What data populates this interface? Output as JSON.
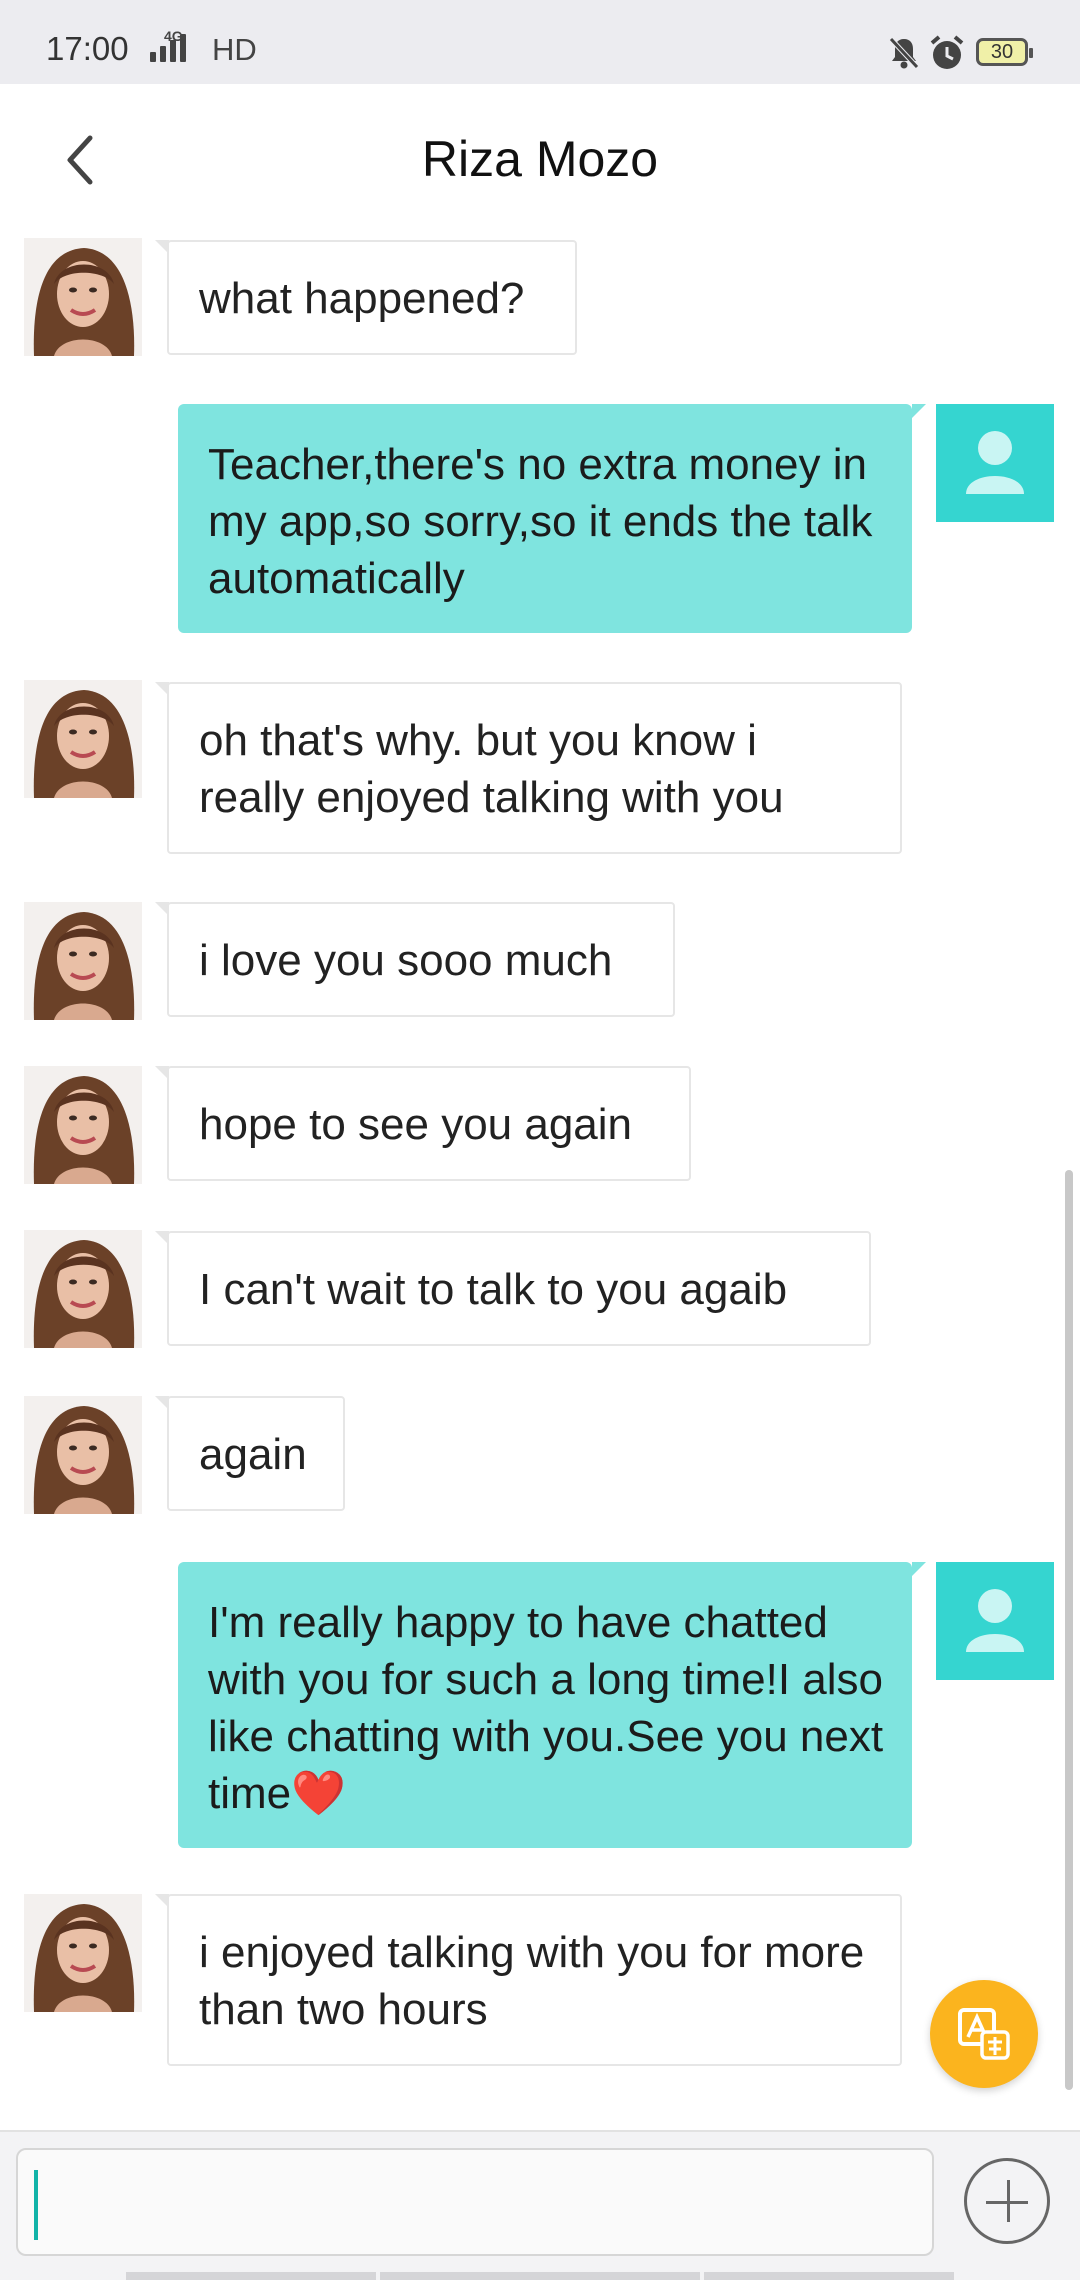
{
  "status_bar": {
    "time": "17:00",
    "network": "4G",
    "hd_label": "HD",
    "icons": [
      "mute-bell-icon",
      "alarm-icon"
    ],
    "battery": "30"
  },
  "header": {
    "back_icon": "chevron-left-icon",
    "title": "Riza Mozo"
  },
  "messages": [
    {
      "side": "in",
      "text": "what happened?"
    },
    {
      "side": "out",
      "text": "Teacher,there's no extra money in my app,so sorry,so it ends the talk automatically"
    },
    {
      "side": "in",
      "text": "oh that's why. but you know i really enjoyed talking with you"
    },
    {
      "side": "in",
      "text": "i love you sooo much"
    },
    {
      "side": "in",
      "text": "hope to see you again"
    },
    {
      "side": "in",
      "text": "I can't wait to talk to you agaib"
    },
    {
      "side": "in",
      "text": "again"
    },
    {
      "side": "out",
      "text": "I'm really happy to have chatted with you for such a long time!I also like chatting with you.See you next time❤️"
    },
    {
      "side": "in",
      "text": "i enjoyed talking with you for more than two hours"
    }
  ],
  "translate_button_icon": "translate-icon",
  "composer": {
    "value": "",
    "placeholder": "",
    "add_icon": "plus-circle-icon"
  },
  "colors": {
    "accent": "#35d5d0",
    "outgoing_bubble": "#7fe4df",
    "fab": "#fbb41e"
  }
}
